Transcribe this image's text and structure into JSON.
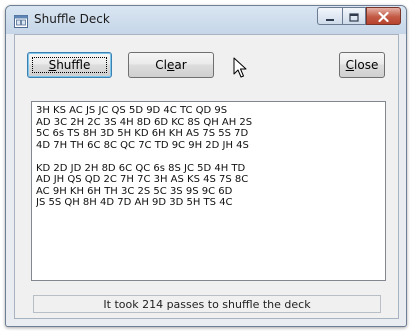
{
  "window": {
    "title": "Shuffle Deck"
  },
  "icons": {
    "app": "cards-window-icon",
    "minimize": "minimize-icon",
    "maximize": "maximize-icon",
    "close": "close-x-icon",
    "cursor": "mouse-pointer-icon"
  },
  "buttons": {
    "shuffle": {
      "label_mnemonic": "S",
      "label_rest": "huffle"
    },
    "clear": {
      "label_pre": "Cl",
      "label_mnemonic": "e",
      "label_rest": "ar"
    },
    "close": {
      "label_mnemonic": "C",
      "label_rest": "lose"
    }
  },
  "output": {
    "block1": [
      "3H KS AC JS JC QS 5D 9D 4C TC QD 9S",
      "AD 3C 2H 2C 3S 4H 8D 6D KC 8S QH AH 2S",
      "5C 6s TS 8H 3D 5H KD 6H KH AS 7S 5S 7D",
      "4D 7H TH 6C 8C QC 7C TD 9C 9H 2D JH 4S"
    ],
    "block2": [
      "KD 2D JD 2H 8D 6C QC 6s 8S JC 5D 4H TD",
      "AD JH QS QD 2C 7H 7C 3H AS KS 4S 7S 8C",
      "AC 9H KH 6H TH 3C 2S 5C 3S 9S 9C 6D",
      "JS 5S QH 8H 4D 7D AH 9D 3D 5H TS 4C"
    ]
  },
  "status": {
    "text": "It took 214 passes to shuffle the deck"
  },
  "colors": {
    "close_button": "#c35a45",
    "titlebar": "#c6d6e8",
    "client_bg": "#f0f0f0"
  }
}
